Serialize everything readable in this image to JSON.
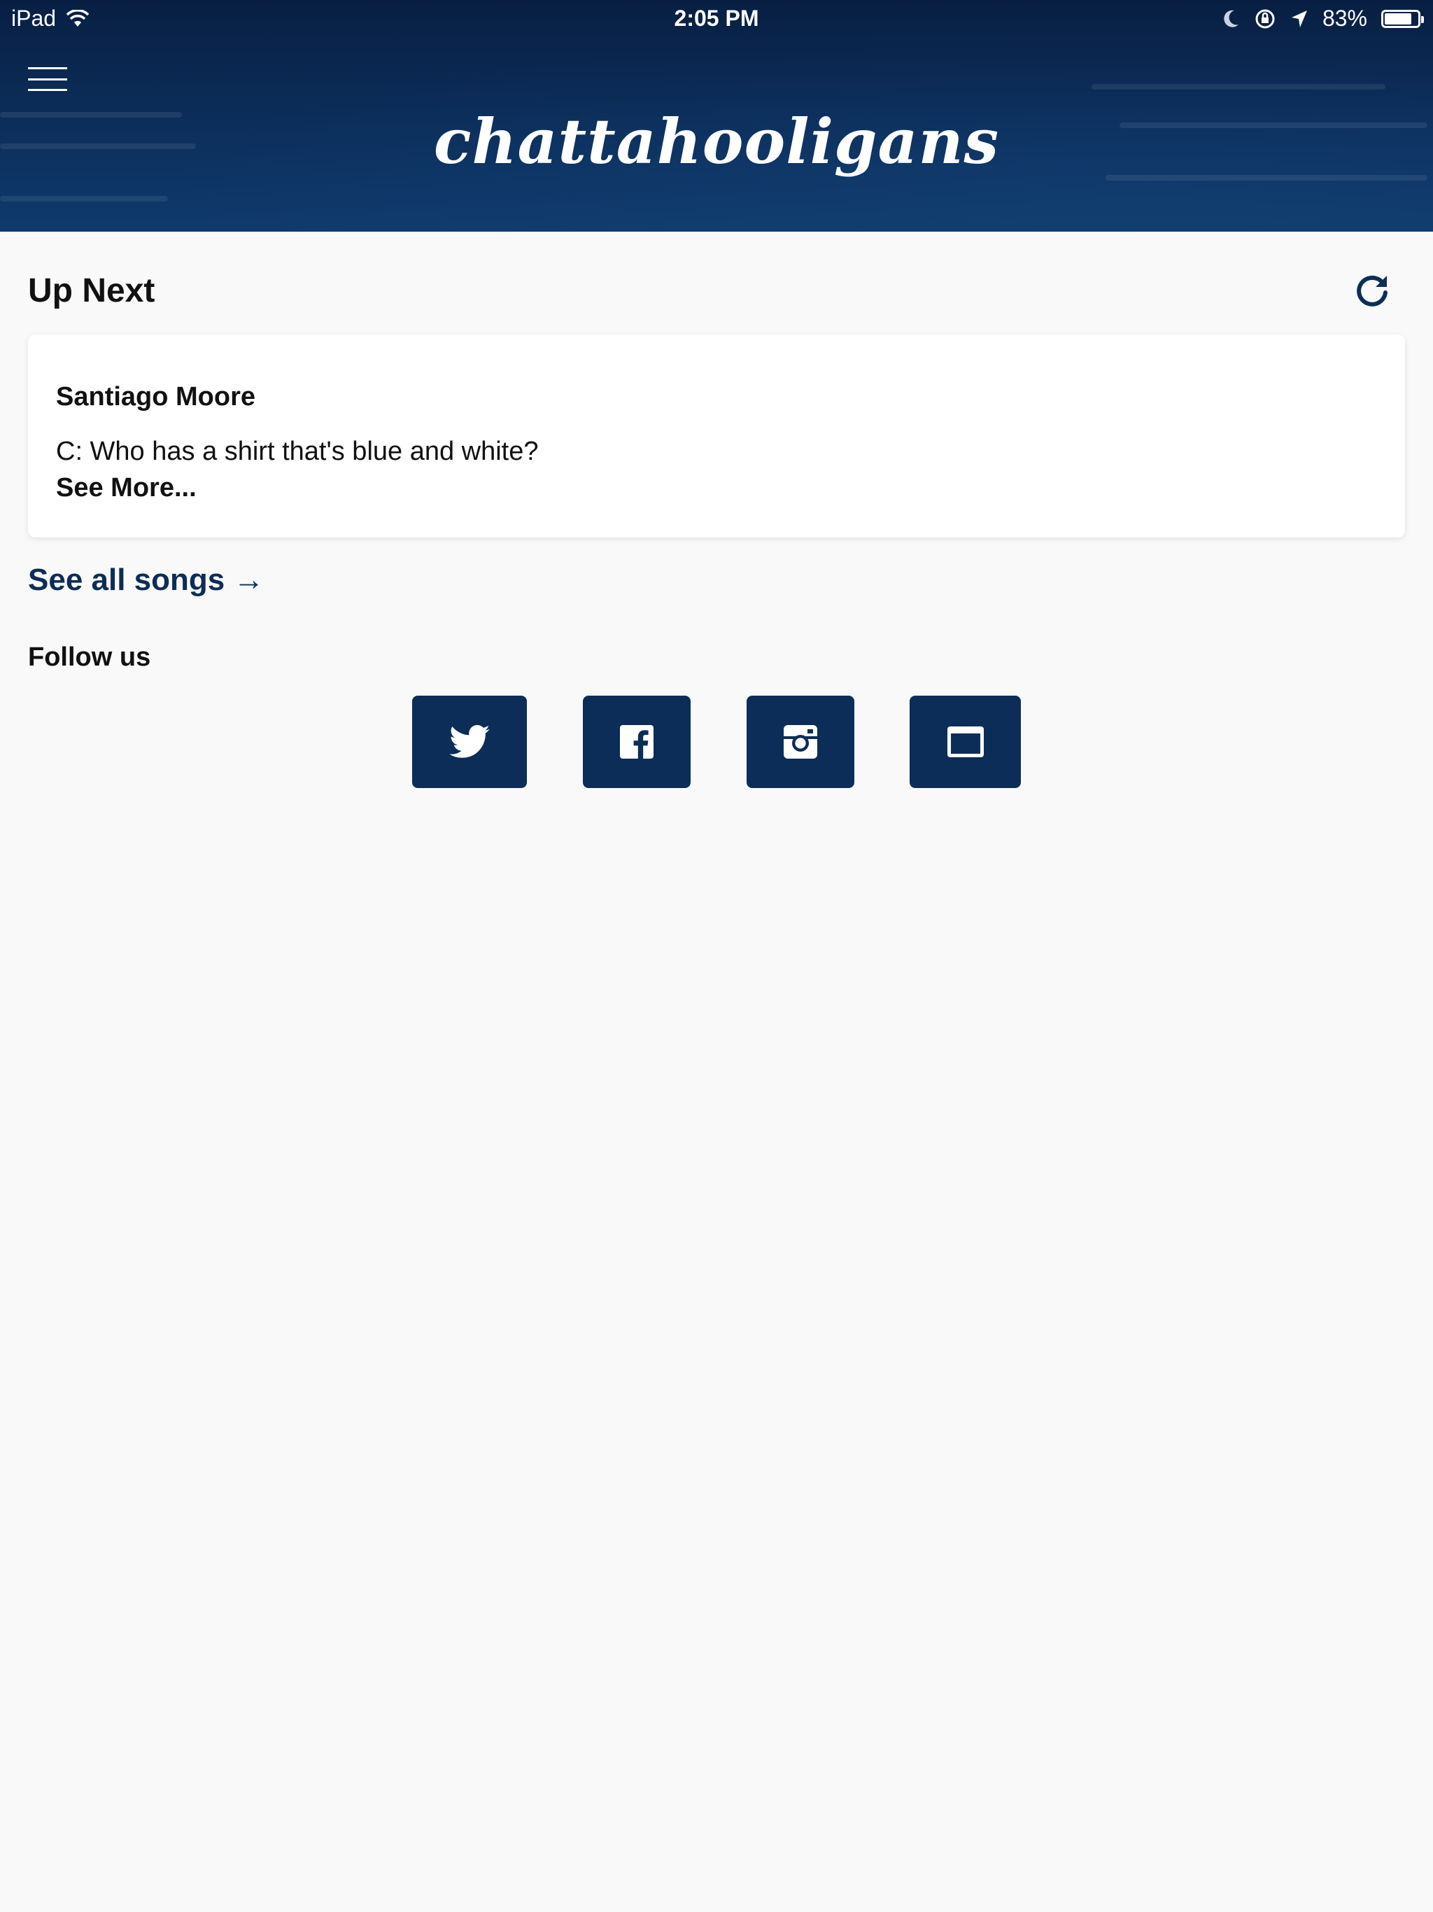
{
  "status_bar": {
    "device": "iPad",
    "time": "2:05 PM",
    "battery_percent": "83%",
    "battery_level": 0.83
  },
  "header": {
    "logo_text": "chattahooligans"
  },
  "up_next": {
    "title": "Up Next",
    "card": {
      "author": "Santiago Moore",
      "lyric": "C: Who has a shirt that's blue and white?",
      "more_label": "See More..."
    }
  },
  "links": {
    "see_all_label": "See all songs",
    "arrow": "→"
  },
  "follow": {
    "title": "Follow us",
    "buttons": [
      {
        "name": "twitter",
        "icon": "twitter-icon"
      },
      {
        "name": "facebook",
        "icon": "facebook-icon"
      },
      {
        "name": "instagram",
        "icon": "instagram-icon"
      },
      {
        "name": "website",
        "icon": "browser-window-icon"
      }
    ]
  },
  "colors": {
    "brand_navy": "#0c2d57",
    "background": "#f9f9f9",
    "card": "#ffffff"
  }
}
